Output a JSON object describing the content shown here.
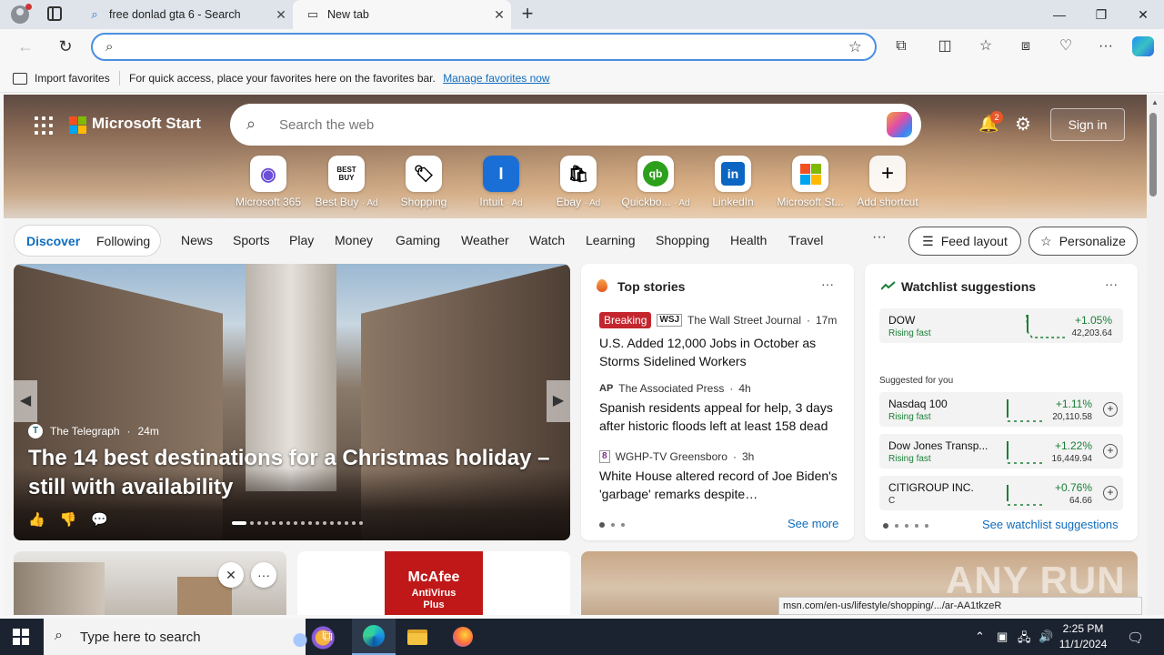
{
  "browser": {
    "tabs": [
      {
        "title": "free donlad gta 6 - Search",
        "icon": "search-icon"
      },
      {
        "title": "New tab",
        "icon": "newtab-page-icon"
      }
    ],
    "omnibox": {
      "value": "",
      "placeholder": ""
    }
  },
  "favorites_bar": {
    "import_label": "Import favorites",
    "message": "For quick access, place your favorites here on the favorites bar.",
    "manage_link": "Manage favorites now"
  },
  "header": {
    "brand": "Microsoft Start",
    "search_placeholder": "Search the web",
    "notification_count": "2",
    "signin_label": "Sign in"
  },
  "shortcuts": [
    {
      "label": "Microsoft 365",
      "ad": "",
      "glyph": "◉",
      "color": "#6b4fd8"
    },
    {
      "label": "Best Buy",
      "ad": "· Ad",
      "glyph": "BEST BUY",
      "color": "#1d1d1d"
    },
    {
      "label": "Shopping",
      "ad": "",
      "glyph": "🏷",
      "color": "#333333"
    },
    {
      "label": "Intuit",
      "ad": "· Ad",
      "glyph": "I",
      "color": "#1a6fd6"
    },
    {
      "label": "Ebay",
      "ad": "· Ad",
      "glyph": "🛍",
      "color": "#333333"
    },
    {
      "label": "Quickbo...",
      "ad": "· Ad",
      "glyph": "qb",
      "color": "#2ca01c"
    },
    {
      "label": "LinkedIn",
      "ad": "",
      "glyph": "in",
      "color": "#0a66c2"
    },
    {
      "label": "Microsoft St...",
      "ad": "",
      "glyph": "▦",
      "color": "#f25022"
    },
    {
      "label": "Add shortcut",
      "ad": "",
      "glyph": "+",
      "color": "#333333"
    }
  ],
  "feed_nav": {
    "discover": "Discover",
    "following": "Following",
    "items": [
      "News",
      "Sports",
      "Play",
      "Money",
      "Gaming",
      "Weather",
      "Watch",
      "Learning",
      "Shopping",
      "Health",
      "Travel"
    ],
    "more": "···",
    "feed_layout": "Feed layout",
    "personalize": "Personalize"
  },
  "hero": {
    "source": "The Telegraph",
    "time": "24m",
    "title": "The 14 best destinations for a Christmas holiday – still with availability"
  },
  "top_stories": {
    "title": "Top stories",
    "more": "···",
    "items": [
      {
        "badge": "Breaking",
        "source": "The Wall Street Journal",
        "time": "17m",
        "logo": "WSJ",
        "headline": "U.S. Added 12,000 Jobs in October as Storms Sidelined Workers"
      },
      {
        "badge": "",
        "source": "The Associated Press",
        "time": "4h",
        "logo": "AP",
        "headline": "Spanish residents appeal for help, 3 days after historic floods left at least 158 dead"
      },
      {
        "badge": "",
        "source": "WGHP-TV Greensboro",
        "time": "3h",
        "logo": "8",
        "headline": "White House altered record of Joe Biden's 'garbage' remarks despite…"
      }
    ],
    "see_more": "See more"
  },
  "watchlist": {
    "title": "Watchlist suggestions",
    "more": "···",
    "featured": {
      "name": "DOW",
      "status": "Rising fast",
      "change": "+1.05%",
      "price": "42,203.64"
    },
    "suggested_label": "Suggested for you",
    "stocks": [
      {
        "name": "Nasdaq 100",
        "status": "Rising fast",
        "change": "+1.11%",
        "price": "20,110.58"
      },
      {
        "name": "Dow Jones Transp...",
        "status": "Rising fast",
        "change": "+1.22%",
        "price": "16,449.94"
      },
      {
        "name": "CITIGROUP INC.",
        "status": "C",
        "change": "+0.76%",
        "price": "64.66"
      }
    ],
    "see_suggestions": "See watchlist suggestions"
  },
  "ad": {
    "brand": "McAfee",
    "product": "AntiVirus Plus"
  },
  "status_url": "msn.com/en-us/lifestyle/shopping/.../ar-AA1tkzeR",
  "watermark": "ANY RUN",
  "taskbar": {
    "search_placeholder": "Type here to search",
    "time": "2:25 PM",
    "date": "11/1/2024"
  },
  "colors": {
    "accent": "#0f6cbd",
    "breaking": "#c4262e",
    "positive": "#1a7f37"
  }
}
